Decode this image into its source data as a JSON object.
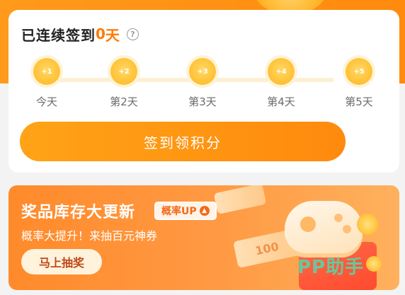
{
  "checkin": {
    "title_prefix": "已连续签到",
    "days": "0",
    "unit": "天",
    "help_icon": "?",
    "steps": [
      {
        "reward": "+1",
        "label": "今天"
      },
      {
        "reward": "+2",
        "label": "第2天"
      },
      {
        "reward": "+3",
        "label": "第3天"
      },
      {
        "reward": "+4",
        "label": "第4天"
      },
      {
        "reward": "+5",
        "label": "第5天"
      }
    ],
    "button_label": "签到领积分"
  },
  "promo": {
    "title": "奖品库存大更新",
    "badge": "概率UP",
    "subtitle": "概率大提升！来抽百元神券",
    "button_label": "马上抽奖",
    "ticket_value": "100",
    "watermark": "PP助手"
  },
  "colors": {
    "accent": "#ff8a0e",
    "days_highlight": "#ff7a00",
    "banner": "#ff9a44"
  }
}
